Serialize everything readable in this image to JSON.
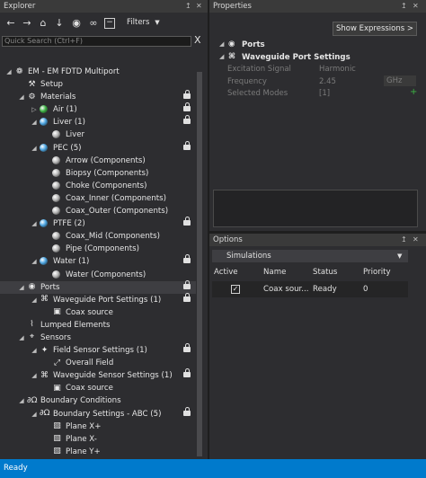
{
  "explorer": {
    "title": "Explorer",
    "pin": "↥",
    "close": "✕",
    "filters_label": "Filters",
    "search_placeholder": "Quick Search (Ctrl+F)",
    "search_clear": "X",
    "tree": [
      {
        "label": "EM - EM FDTD Multiport",
        "icon": "em-icon",
        "glyph": "❁",
        "depth": 0,
        "arrow": "◢",
        "lock": false
      },
      {
        "label": "Setup",
        "icon": "setup-icon",
        "glyph": "⚒",
        "depth": 1,
        "arrow": "",
        "lock": false
      },
      {
        "label": "Materials",
        "icon": "gear-icon",
        "glyph": "⚙",
        "depth": 1,
        "arrow": "◢",
        "lock": true
      },
      {
        "label": "Air (1)",
        "icon": "sphere-green-icon",
        "sphere": "#3cb043",
        "depth": 2,
        "arrow": "▷",
        "lock": true
      },
      {
        "label": "Liver (1)",
        "icon": "sphere-blue-icon",
        "sphere": "#4aa3df",
        "depth": 2,
        "arrow": "◢",
        "lock": true
      },
      {
        "label": "Liver",
        "icon": "sphere-gray-icon",
        "sphere": "#b5b5b5",
        "depth": 3,
        "arrow": "",
        "lock": false
      },
      {
        "label": "PEC (5)",
        "icon": "sphere-blue-icon",
        "sphere": "#4aa3df",
        "depth": 2,
        "arrow": "◢",
        "lock": true
      },
      {
        "label": "Arrow  (Components)",
        "icon": "sphere-gray-icon",
        "sphere": "#b5b5b5",
        "depth": 3,
        "arrow": "",
        "lock": false
      },
      {
        "label": "Biopsy  (Components)",
        "icon": "sphere-gray-icon",
        "sphere": "#b5b5b5",
        "depth": 3,
        "arrow": "",
        "lock": false
      },
      {
        "label": "Choke  (Components)",
        "icon": "sphere-gray-icon",
        "sphere": "#b5b5b5",
        "depth": 3,
        "arrow": "",
        "lock": false
      },
      {
        "label": "Coax_Inner  (Components)",
        "icon": "sphere-gray-icon",
        "sphere": "#b5b5b5",
        "depth": 3,
        "arrow": "",
        "lock": false
      },
      {
        "label": "Coax_Outer  (Components)",
        "icon": "sphere-gray-icon",
        "sphere": "#b5b5b5",
        "depth": 3,
        "arrow": "",
        "lock": false
      },
      {
        "label": "PTFE (2)",
        "icon": "sphere-blue-icon",
        "sphere": "#4aa3df",
        "depth": 2,
        "arrow": "◢",
        "lock": true
      },
      {
        "label": "Coax_Mid  (Components)",
        "icon": "sphere-gray-icon",
        "sphere": "#b5b5b5",
        "depth": 3,
        "arrow": "",
        "lock": false
      },
      {
        "label": "Pipe  (Components)",
        "icon": "sphere-gray-icon",
        "sphere": "#b5b5b5",
        "depth": 3,
        "arrow": "",
        "lock": false
      },
      {
        "label": "Water (1)",
        "icon": "sphere-blue-icon",
        "sphere": "#4aa3df",
        "depth": 2,
        "arrow": "◢",
        "lock": true
      },
      {
        "label": "Water  (Components)",
        "icon": "sphere-gray-icon",
        "sphere": "#b5b5b5",
        "depth": 3,
        "arrow": "",
        "lock": false
      },
      {
        "label": "Ports",
        "icon": "ports-icon",
        "glyph": "◉",
        "depth": 1,
        "arrow": "◢",
        "lock": true,
        "selected": true
      },
      {
        "label": "Waveguide Port Settings (1)",
        "icon": "waveguide-port-icon",
        "glyph": "⌘",
        "depth": 2,
        "arrow": "◢",
        "lock": true
      },
      {
        "label": "Coax source",
        "icon": "port-source-icon",
        "glyph": "▣",
        "depth": 3,
        "arrow": "",
        "lock": false
      },
      {
        "label": "Lumped Elements",
        "icon": "lumped-elements-icon",
        "glyph": "⌇",
        "depth": 1,
        "arrow": "",
        "lock": false
      },
      {
        "label": "Sensors",
        "icon": "sensors-icon",
        "glyph": "⌖",
        "depth": 1,
        "arrow": "◢",
        "lock": false
      },
      {
        "label": "Field Sensor Settings (1)",
        "icon": "field-sensor-icon",
        "glyph": "✦",
        "depth": 2,
        "arrow": "◢",
        "lock": true
      },
      {
        "label": "Overall Field",
        "icon": "overall-field-icon",
        "glyph": "⤢",
        "depth": 3,
        "arrow": "",
        "lock": false
      },
      {
        "label": "Waveguide Sensor Settings (1)",
        "icon": "waveguide-sensor-icon",
        "glyph": "⌘",
        "depth": 2,
        "arrow": "◢",
        "lock": true
      },
      {
        "label": "Coax source",
        "icon": "port-source-icon",
        "glyph": "▣",
        "depth": 3,
        "arrow": "",
        "lock": false
      },
      {
        "label": "Boundary Conditions",
        "icon": "boundary-conditions-icon",
        "glyph": "∂Ω",
        "depth": 1,
        "arrow": "◢",
        "lock": false
      },
      {
        "label": "Boundary Settings - ABC (5)",
        "icon": "boundary-settings-icon",
        "glyph": "∂Ω",
        "depth": 2,
        "arrow": "◢",
        "lock": true
      },
      {
        "label": "Plane X+",
        "icon": "plane-icon",
        "glyph": "▧",
        "depth": 3,
        "arrow": "",
        "lock": false
      },
      {
        "label": "Plane X-",
        "icon": "plane-icon",
        "glyph": "▧",
        "depth": 3,
        "arrow": "",
        "lock": false
      },
      {
        "label": "Plane Y+",
        "icon": "plane-icon",
        "glyph": "▧",
        "depth": 3,
        "arrow": "",
        "lock": false
      }
    ]
  },
  "properties": {
    "title": "Properties",
    "pin": "↥",
    "close": "✕",
    "show_expressions": "Show Expressions >",
    "section1": "Ports",
    "section2": "Waveguide Port Settings",
    "rows": [
      {
        "key": "Excitation Signal",
        "value": "Harmonic"
      },
      {
        "key": "Frequency",
        "value": "2.45",
        "unit": "GHz"
      },
      {
        "key": "Selected Modes",
        "value": "[1]",
        "plus": "+"
      }
    ]
  },
  "options": {
    "title": "Options",
    "pin": "↥",
    "close": "✕",
    "tab": "Simulations",
    "headers": [
      "Active",
      "Name",
      "Status",
      "Priority"
    ],
    "row": {
      "active": true,
      "check": "✓",
      "name": "Coax sour...",
      "status": "Ready",
      "priority": "0"
    }
  },
  "status_bar": {
    "text": "Ready"
  }
}
